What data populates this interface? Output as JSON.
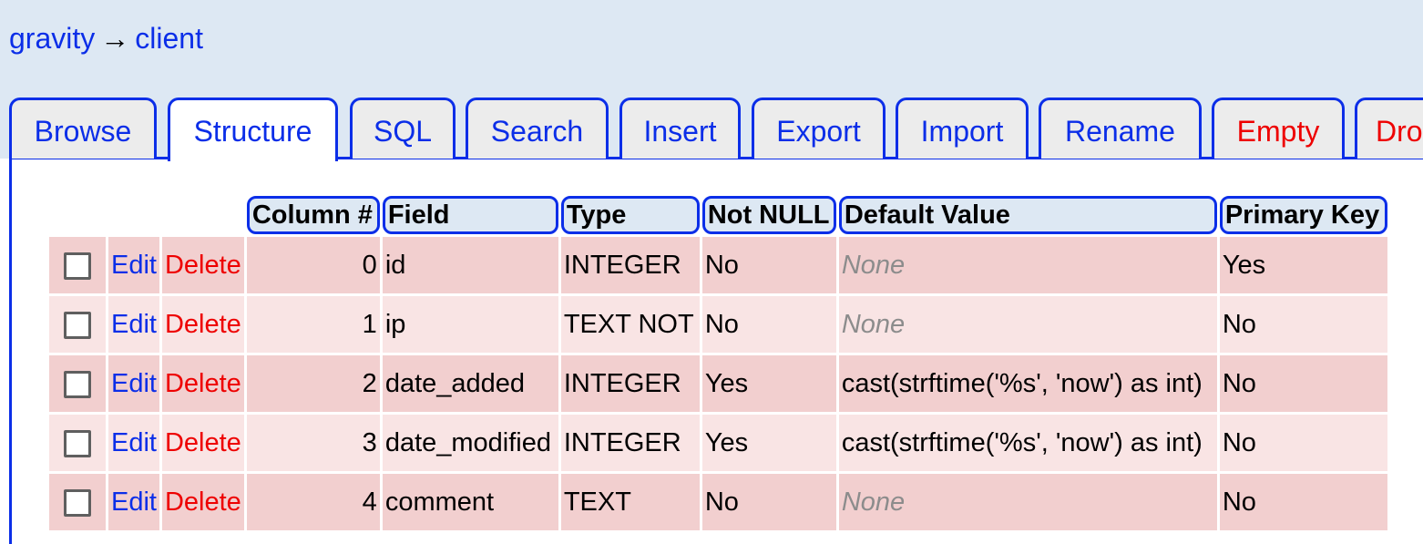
{
  "breadcrumb": {
    "database": "gravity",
    "arrow": "→",
    "table": "client"
  },
  "tabs": [
    {
      "label": "Browse",
      "active": false,
      "danger": false
    },
    {
      "label": "Structure",
      "active": true,
      "danger": false
    },
    {
      "label": "SQL",
      "active": false,
      "danger": false
    },
    {
      "label": "Search",
      "active": false,
      "danger": false
    },
    {
      "label": "Insert",
      "active": false,
      "danger": false
    },
    {
      "label": "Export",
      "active": false,
      "danger": false
    },
    {
      "label": "Import",
      "active": false,
      "danger": false
    },
    {
      "label": "Rename",
      "active": false,
      "danger": false
    },
    {
      "label": "Empty",
      "active": false,
      "danger": true
    },
    {
      "label": "Drop",
      "active": false,
      "danger": true
    }
  ],
  "table": {
    "headers": [
      "Column #",
      "Field",
      "Type",
      "Not NULL",
      "Default Value",
      "Primary Key"
    ],
    "edit_label": "Edit",
    "delete_label": "Delete",
    "rows": [
      {
        "col": "0",
        "field": "id",
        "type": "INTEGER",
        "notnull": "No",
        "default": "None",
        "default_is_none": true,
        "pk": "Yes"
      },
      {
        "col": "1",
        "field": "ip",
        "type": "TEXT NOT NULL",
        "notnull": "No",
        "default": "None",
        "default_is_none": true,
        "pk": "No"
      },
      {
        "col": "2",
        "field": "date_added",
        "type": "INTEGER",
        "notnull": "Yes",
        "default": "cast(strftime('%s', 'now') as int)",
        "default_is_none": false,
        "pk": "No"
      },
      {
        "col": "3",
        "field": "date_modified",
        "type": "INTEGER",
        "notnull": "Yes",
        "default": "cast(strftime('%s', 'now') as int)",
        "default_is_none": false,
        "pk": "No"
      },
      {
        "col": "4",
        "field": "comment",
        "type": "TEXT",
        "notnull": "No",
        "default": "None",
        "default_is_none": true,
        "pk": "No"
      }
    ]
  },
  "colors": {
    "link": "#0b2ee8",
    "danger": "#ee0000",
    "header_bg": "#dde8f3",
    "row_odd": "#f2cfcf",
    "row_even": "#f9e4e4"
  }
}
